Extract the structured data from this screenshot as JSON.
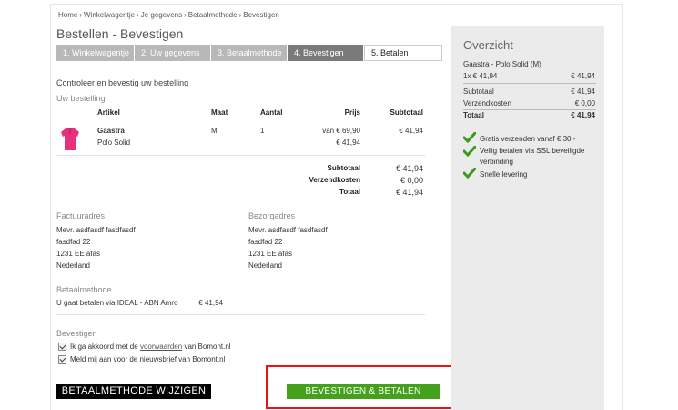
{
  "breadcrumb": [
    "Home",
    "Winkelwagentje",
    "Je gegevens",
    "Betaalmethode",
    "Bevestigen"
  ],
  "breadcrumb_sep": "›",
  "page_title": "Bestellen - Bevestigen",
  "steps": [
    {
      "label": "1. Winkelwagentje",
      "state": "done"
    },
    {
      "label": "2. Uw gegevens",
      "state": "done"
    },
    {
      "label": "3. Betaalmethode",
      "state": "done"
    },
    {
      "label": "4. Bevestigen",
      "state": "active"
    },
    {
      "label": "5. Betalen",
      "state": "todo"
    }
  ],
  "intro": "Controleer en bevestig uw bestelling",
  "order": {
    "heading": "Uw bestelling",
    "columns": {
      "artikel": "Artikel",
      "maat": "Maat",
      "aantal": "Aantal",
      "prijs": "Prijs",
      "subtotaal": "Subtotaal"
    },
    "item": {
      "brand": "Gaastra",
      "name": "Polo Solid",
      "size": "M",
      "qty": "1",
      "price_was": "van € 69,90",
      "price_now": "€ 41,94",
      "subtotal": "€ 41,94",
      "image_color": "#e8307c"
    },
    "totals": [
      {
        "label": "Subtotaal",
        "value": "€ 41,94"
      },
      {
        "label": "Verzendkosten",
        "value": "€ 0,00"
      },
      {
        "label": "Totaal",
        "value": "€ 41,94"
      }
    ]
  },
  "invoice_address": {
    "heading": "Factuuradres",
    "lines": [
      "Mevr. asdfasdf fasdfasdf",
      "fasdfad 22",
      "1231 EE afas",
      "Nederland"
    ]
  },
  "delivery_address": {
    "heading": "Bezorgadres",
    "lines": [
      "Mevr. asdfasdf fasdfasdf",
      "fasdfad 22",
      "1231 EE afas",
      "Nederland"
    ]
  },
  "payment": {
    "heading": "Betaalmethode",
    "text": "U gaat betalen via IDEAL - ABN Amro",
    "amount": "€ 41,94"
  },
  "confirm": {
    "heading": "Bevestigen",
    "terms_pre": "Ik ga akkoord met de",
    "terms_link": "voorwaarden",
    "terms_post": "van Bomont.nl",
    "newsletter": "Meld mij aan voor de nieuwsbrief van Bomont.nl"
  },
  "buttons": {
    "back": "BETAALMETHODE WIJZIGEN",
    "confirm": "BEVESTIGEN & BETALEN"
  },
  "overview": {
    "title": "Overzicht",
    "product": "Gaastra - Polo Solid (M)",
    "line_qty": "1x € 41,94",
    "line_amount": "€ 41,94",
    "rows": [
      {
        "label": "Subtotaal",
        "value": "€ 41,94"
      },
      {
        "label": "Verzendkosten",
        "value": "€ 0,00"
      },
      {
        "label": "Totaal",
        "value": "€ 41,94"
      }
    ],
    "features": [
      [
        "Gratis verzenden vanaf € 30,-"
      ],
      [
        "Veilig betalen via SSL beveiligde",
        "verbinding"
      ],
      [
        "Snelle levering"
      ]
    ]
  },
  "colors": {
    "accent_green": "#44a11b",
    "highlight_red": "#e11111",
    "check_green": "#3a9a1a"
  }
}
